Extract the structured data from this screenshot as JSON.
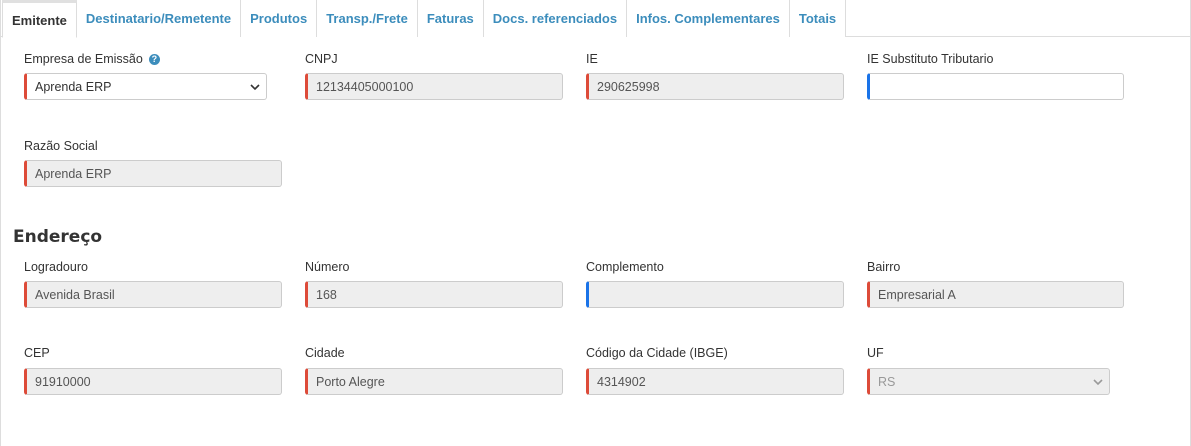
{
  "tabs": [
    {
      "label": "Emitente",
      "active": true
    },
    {
      "label": "Destinatario/Remetente",
      "active": false
    },
    {
      "label": "Produtos",
      "active": false
    },
    {
      "label": "Transp./Frete",
      "active": false
    },
    {
      "label": "Faturas",
      "active": false
    },
    {
      "label": "Docs. referenciados",
      "active": false
    },
    {
      "label": "Infos. Complementares",
      "active": false
    },
    {
      "label": "Totais",
      "active": false
    }
  ],
  "emitente": {
    "empresa_label": "Empresa de Emissão",
    "empresa_value": "Aprenda ERP",
    "cnpj_label": "CNPJ",
    "cnpj_value": "12134405000100",
    "ie_label": "IE",
    "ie_value": "290625998",
    "ie_st_label": "IE Substituto Tributario",
    "ie_st_value": "",
    "razao_label": "Razão Social",
    "razao_value": "Aprenda ERP"
  },
  "endereco": {
    "title": "Endereço",
    "logradouro_label": "Logradouro",
    "logradouro_value": "Avenida Brasil",
    "numero_label": "Número",
    "numero_value": "168",
    "complemento_label": "Complemento",
    "complemento_value": "",
    "bairro_label": "Bairro",
    "bairro_value": "Empresarial A",
    "cep_label": "CEP",
    "cep_value": "91910000",
    "cidade_label": "Cidade",
    "cidade_value": "Porto Alegre",
    "ibge_label": "Código da Cidade (IBGE)",
    "ibge_value": "4314902",
    "uf_label": "UF",
    "uf_value": "RS"
  },
  "colors": {
    "required": "#dd4b39",
    "optional": "#1a73e8",
    "link": "#3c8dbc"
  }
}
